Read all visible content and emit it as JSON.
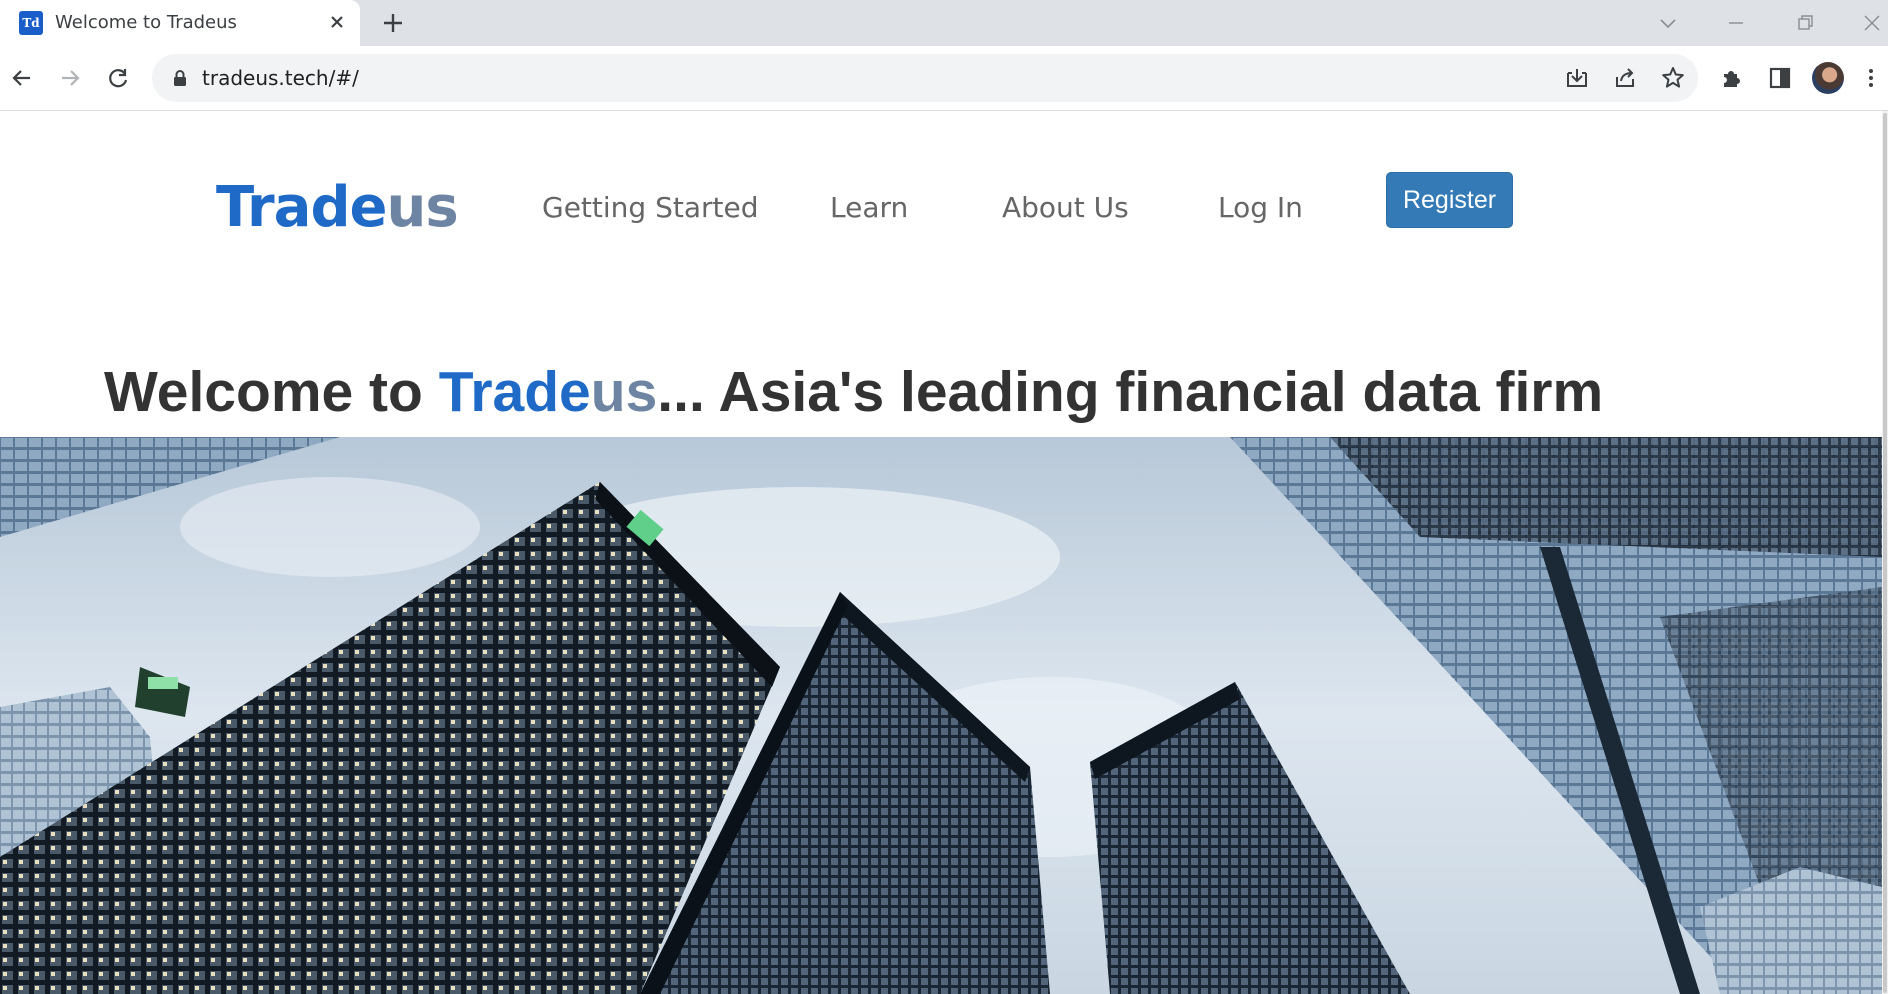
{
  "browser": {
    "tab_title": "Welcome to Tradeus",
    "favicon_text": "Td",
    "url": "tradeus.tech/#/"
  },
  "site": {
    "logo_part1": "Trade",
    "logo_part2": "us",
    "nav": {
      "getting_started": "Getting Started",
      "learn": "Learn",
      "about_us": "About Us",
      "log_in": "Log In",
      "register": "Register"
    },
    "headline": {
      "prefix": "Welcome to ",
      "brand1": "Trade",
      "brand2": "us",
      "suffix": "... Asia's leading financial data firm"
    }
  },
  "colors": {
    "brand_blue": "#1f6ac6",
    "brand_gray": "#6e84a3",
    "button_blue": "#337ab7"
  },
  "icons": [
    "back-icon",
    "forward-icon",
    "reload-icon",
    "lock-icon",
    "install-icon",
    "share-icon",
    "bookmark-star-icon",
    "extensions-icon",
    "side-panel-icon",
    "menu-dots-icon",
    "close-icon",
    "plus-icon"
  ]
}
